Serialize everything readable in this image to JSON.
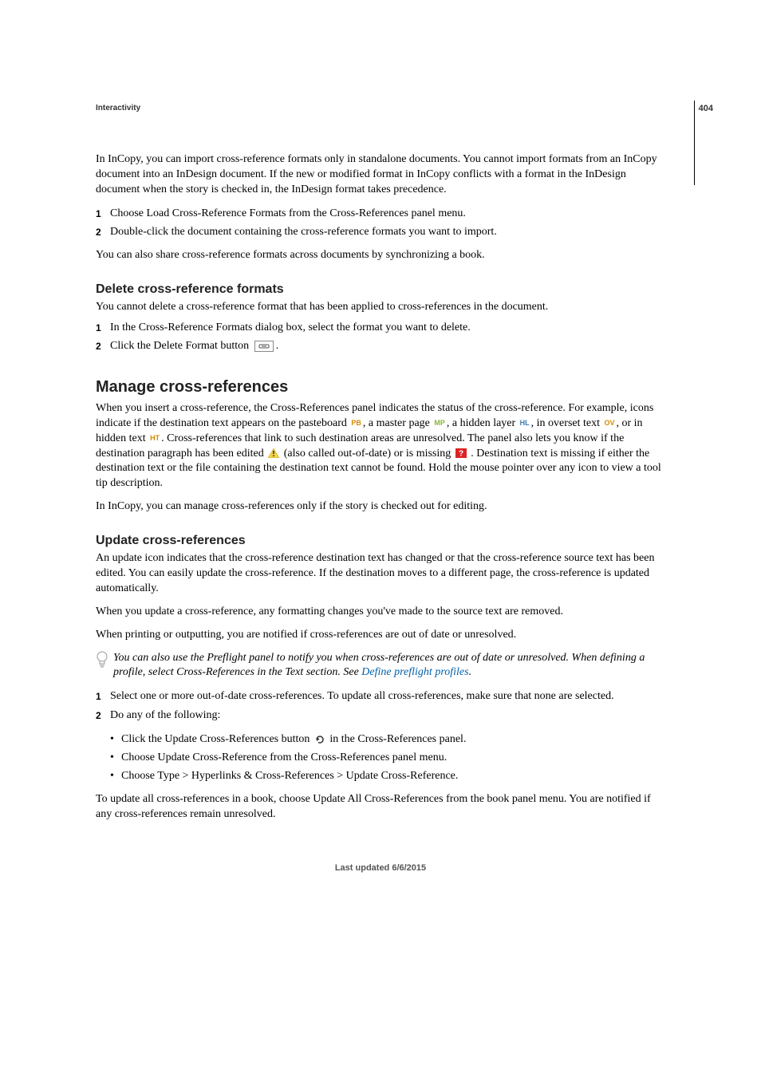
{
  "pageNumber": "404",
  "sectionTag": "Interactivity",
  "intro": "In InCopy, you can import cross-reference formats only in standalone documents. You cannot import formats from an InCopy document into an InDesign document. If the new or modified format in InCopy conflicts with a format in the InDesign document when the story is checked in, the InDesign format takes precedence.",
  "steps1": {
    "s1": "Choose Load Cross-Reference Formats from the Cross-References panel menu.",
    "s2": "Double-click the document containing the cross-reference formats you want to import."
  },
  "afterSteps1": "You can also share cross-reference formats across documents by synchronizing a book.",
  "deleteHeading": "Delete cross-reference formats",
  "deleteIntro": "You cannot delete a cross-reference format that has been applied to cross-references in the document.",
  "steps2": {
    "s1": "In the Cross-Reference Formats dialog box, select the format you want to delete.",
    "s2_pre": "Click the Delete Format button ",
    "s2_post": "."
  },
  "manageHeading": "Manage cross-references",
  "manage": {
    "p1_a": "When you insert a cross-reference, the Cross-References panel indicates the status of the cross-reference. For example, icons indicate if the destination text appears on the pasteboard ",
    "p1_b": ", a master page ",
    "p1_c": ", a hidden layer ",
    "p1_d": ", in overset text ",
    "p1_e": ", or in hidden text ",
    "p1_f": ". Cross-references that link to such destination areas are unresolved. The panel also lets you know if the destination paragraph has been edited ",
    "p1_g": " (also called out-of-date) or is missing ",
    "p1_h": " . Destination text is missing if either the destination text or the file containing the destination text cannot be found. Hold the mouse pointer over any icon to view a tool tip description.",
    "p2": "In InCopy, you can manage cross-references only if the story is checked out for editing."
  },
  "icons": {
    "pb": "PB",
    "mp": "MP",
    "hl": "HL",
    "ov": "OV",
    "ht": "HT"
  },
  "updateHeading": "Update cross-references",
  "update": {
    "p1": "An update icon indicates that the cross-reference destination text has changed or that the cross-reference source text has been edited. You can easily update the cross-reference. If the destination moves to a different page, the cross-reference is updated automatically.",
    "p2": "When you update a cross-reference, any formatting changes you've made to the source text are removed.",
    "p3": "When printing or outputting, you are notified if cross-references are out of date or unresolved."
  },
  "tip": {
    "pre": "You can also use the Preflight panel to notify you when cross-references are out of date or unresolved. When defining a profile, select Cross-References in the Text section. See ",
    "link": "Define preflight profiles",
    "post": "."
  },
  "steps3": {
    "s1": "Select one or more out-of-date cross-references. To update all cross-references, make sure that none are selected.",
    "s2": "Do any of the following:"
  },
  "bullets": {
    "b1_pre": "Click the Update Cross-References button ",
    "b1_post": " in the Cross-References panel.",
    "b2": "Choose Update Cross-Reference from the Cross-References panel menu.",
    "b3": "Choose Type > Hyperlinks & Cross-References > Update Cross-Reference."
  },
  "afterSteps3": "To update all cross-references in a book, choose Update All Cross-References from the book panel menu. You are notified if any cross-references remain unresolved.",
  "footer": "Last updated 6/6/2015"
}
